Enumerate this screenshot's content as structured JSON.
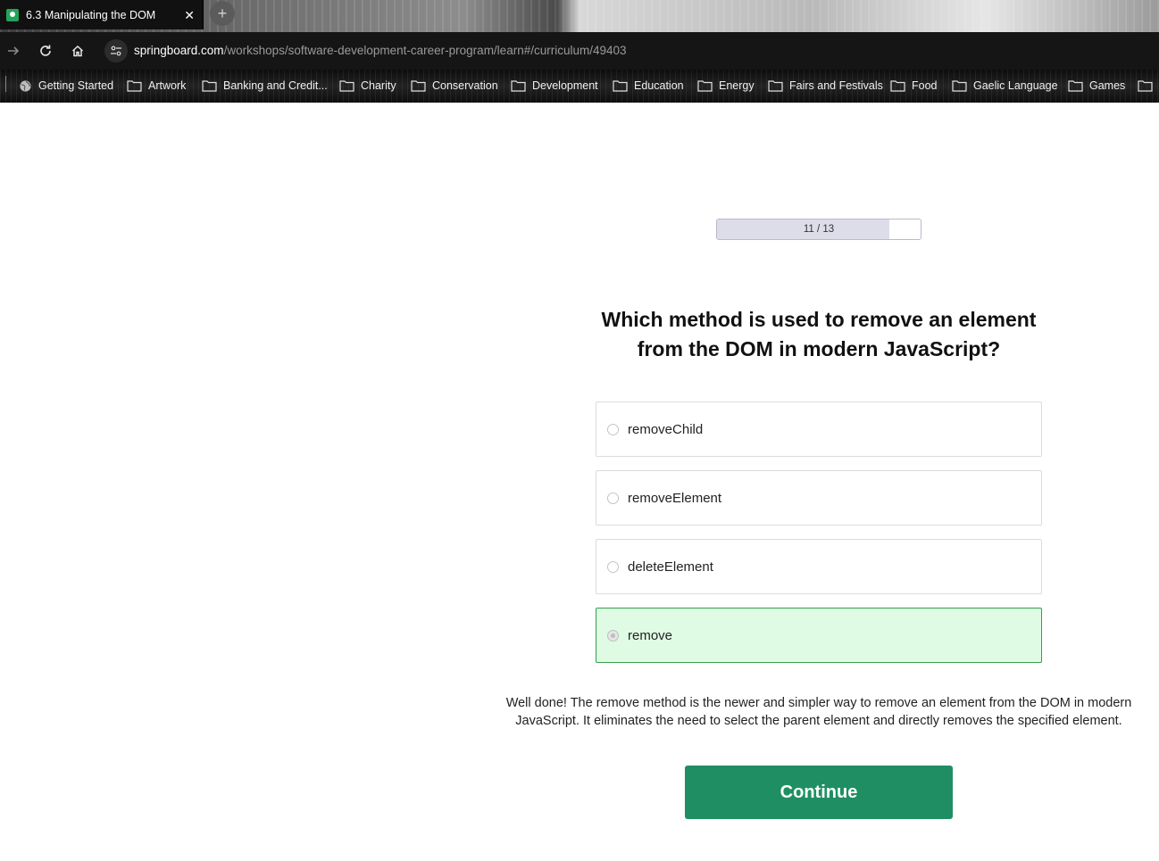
{
  "browser": {
    "tab": {
      "title": "6.3 Manipulating the DOM",
      "close_icon": "close-icon",
      "favicon_color": "#24a35a"
    },
    "new_tab_symbol": "+",
    "address_bar": {
      "host": "springboard.com",
      "path": "/workshops/software-development-career-program/learn#/curriculum/49403"
    },
    "bookmarks": [
      {
        "label": "Getting Started",
        "icon": "globe-icon"
      },
      {
        "label": "Artwork",
        "icon": "folder-icon"
      },
      {
        "label": "Banking and Credit...",
        "icon": "folder-icon"
      },
      {
        "label": "Charity",
        "icon": "folder-icon"
      },
      {
        "label": "Conservation",
        "icon": "folder-icon"
      },
      {
        "label": "Development",
        "icon": "folder-icon"
      },
      {
        "label": "Education",
        "icon": "folder-icon"
      },
      {
        "label": "Energy",
        "icon": "folder-icon"
      },
      {
        "label": "Fairs and Festivals",
        "icon": "folder-icon"
      },
      {
        "label": "Food",
        "icon": "folder-icon"
      },
      {
        "label": "Gaelic Language",
        "icon": "folder-icon"
      },
      {
        "label": "Games",
        "icon": "folder-icon"
      }
    ]
  },
  "quiz": {
    "progress": {
      "current": 11,
      "total": 13,
      "label": "11 / 13",
      "fill_fraction": 0.846
    },
    "question": "Which method is used to remove an element from the DOM in modern JavaScript?",
    "options": [
      {
        "label": "removeChild",
        "state": "default"
      },
      {
        "label": "removeElement",
        "state": "default"
      },
      {
        "label": "deleteElement",
        "state": "default"
      },
      {
        "label": "remove",
        "state": "correct-selected"
      }
    ],
    "feedback": "Well done! The remove method is the newer and simpler way to remove an element from the DOM in modern JavaScript. It eliminates the need to select the parent element and directly removes the specified element.",
    "continue_label": "Continue",
    "colors": {
      "accent": "#1f8f63",
      "correct_bg": "#e0fbe4",
      "correct_border": "#35a04b"
    }
  }
}
